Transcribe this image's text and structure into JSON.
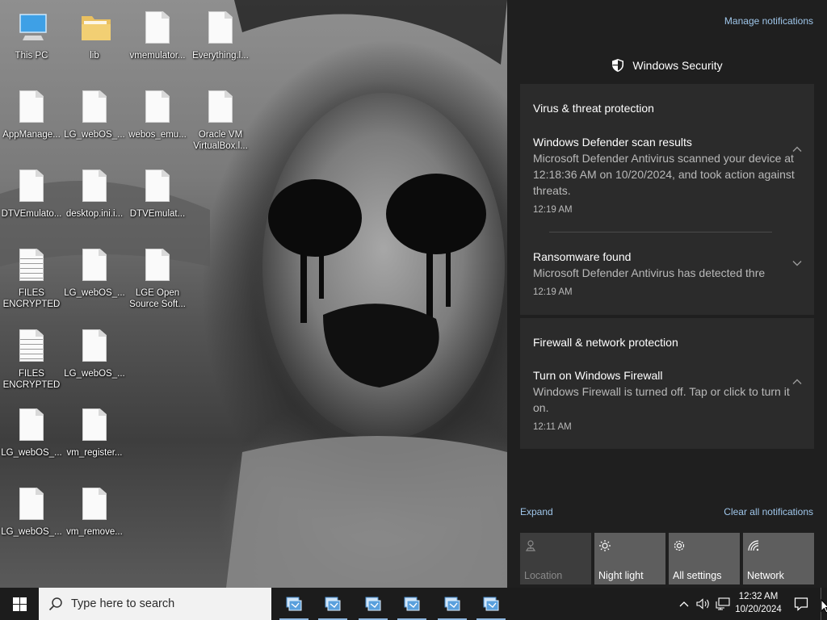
{
  "desktop": {
    "icons": [
      {
        "label": "This PC",
        "type": "pc"
      },
      {
        "label": "lib",
        "type": "folder"
      },
      {
        "label": "vmemulator...",
        "type": "doc"
      },
      {
        "label": "Everything.l...",
        "type": "doc"
      },
      {
        "label": "AppManage...",
        "type": "doc"
      },
      {
        "label": "LG_webOS_...",
        "type": "doc"
      },
      {
        "label": "webos_emu...",
        "type": "doc"
      },
      {
        "label": "Oracle VM VirtualBox.l...",
        "type": "doc"
      },
      {
        "label": "DTVEmulato...",
        "type": "doc"
      },
      {
        "label": "desktop.ini.i...",
        "type": "doc"
      },
      {
        "label": "DTVEmulat...",
        "type": "doc"
      },
      {
        "label": "FILES ENCRYPTED",
        "type": "text"
      },
      {
        "label": "LG_webOS_...",
        "type": "doc"
      },
      {
        "label": "LGE Open Source Soft...",
        "type": "doc"
      },
      {
        "label": "FILES ENCRYPTED",
        "type": "text"
      },
      {
        "label": "LG_webOS_...",
        "type": "doc"
      },
      {
        "label": "LG_webOS_...",
        "type": "doc"
      },
      {
        "label": "vm_register...",
        "type": "doc"
      },
      {
        "label": "LG_webOS_...",
        "type": "doc"
      },
      {
        "label": "vm_remove...",
        "type": "doc"
      }
    ]
  },
  "action_center": {
    "manage_notifications": "Manage notifications",
    "app_header": "Windows Security",
    "groups": [
      {
        "title": "Virus & threat protection",
        "notifications": [
          {
            "title": "Windows Defender scan results",
            "body": "Microsoft Defender Antivirus scanned your device at 12:18:36 AM on 10/20/2024, and took action against threats.",
            "time": "12:19 AM",
            "expanded": true
          },
          {
            "title": "Ransomware found",
            "body": "Microsoft Defender Antivirus has detected thre",
            "time": "12:19 AM",
            "expanded": false
          }
        ]
      },
      {
        "title": "Firewall & network protection",
        "notifications": [
          {
            "title": "Turn on Windows Firewall",
            "body": "Windows Firewall is turned off. Tap or click to turn it on.",
            "time": "12:11 AM",
            "expanded": true
          }
        ]
      }
    ],
    "expand_label": "Expand",
    "clear_label": "Clear all notifications",
    "quick_actions": [
      {
        "label": "Location",
        "icon": "location-icon",
        "enabled": false
      },
      {
        "label": "Night light",
        "icon": "night-light-icon",
        "enabled": true
      },
      {
        "label": "All settings",
        "icon": "settings-icon",
        "enabled": true
      },
      {
        "label": "Network",
        "icon": "network-icon",
        "enabled": true
      }
    ]
  },
  "taskbar": {
    "search_placeholder": "Type here to search",
    "running_apps": 6,
    "clock_time": "12:32 AM",
    "clock_date": "10/20/2024"
  },
  "colors": {
    "accent_link": "#9fc6ea",
    "action_center_bg": "#1f1f1f",
    "card_bg": "#2b2b2b",
    "tile_bg": "#5e5e5e"
  }
}
